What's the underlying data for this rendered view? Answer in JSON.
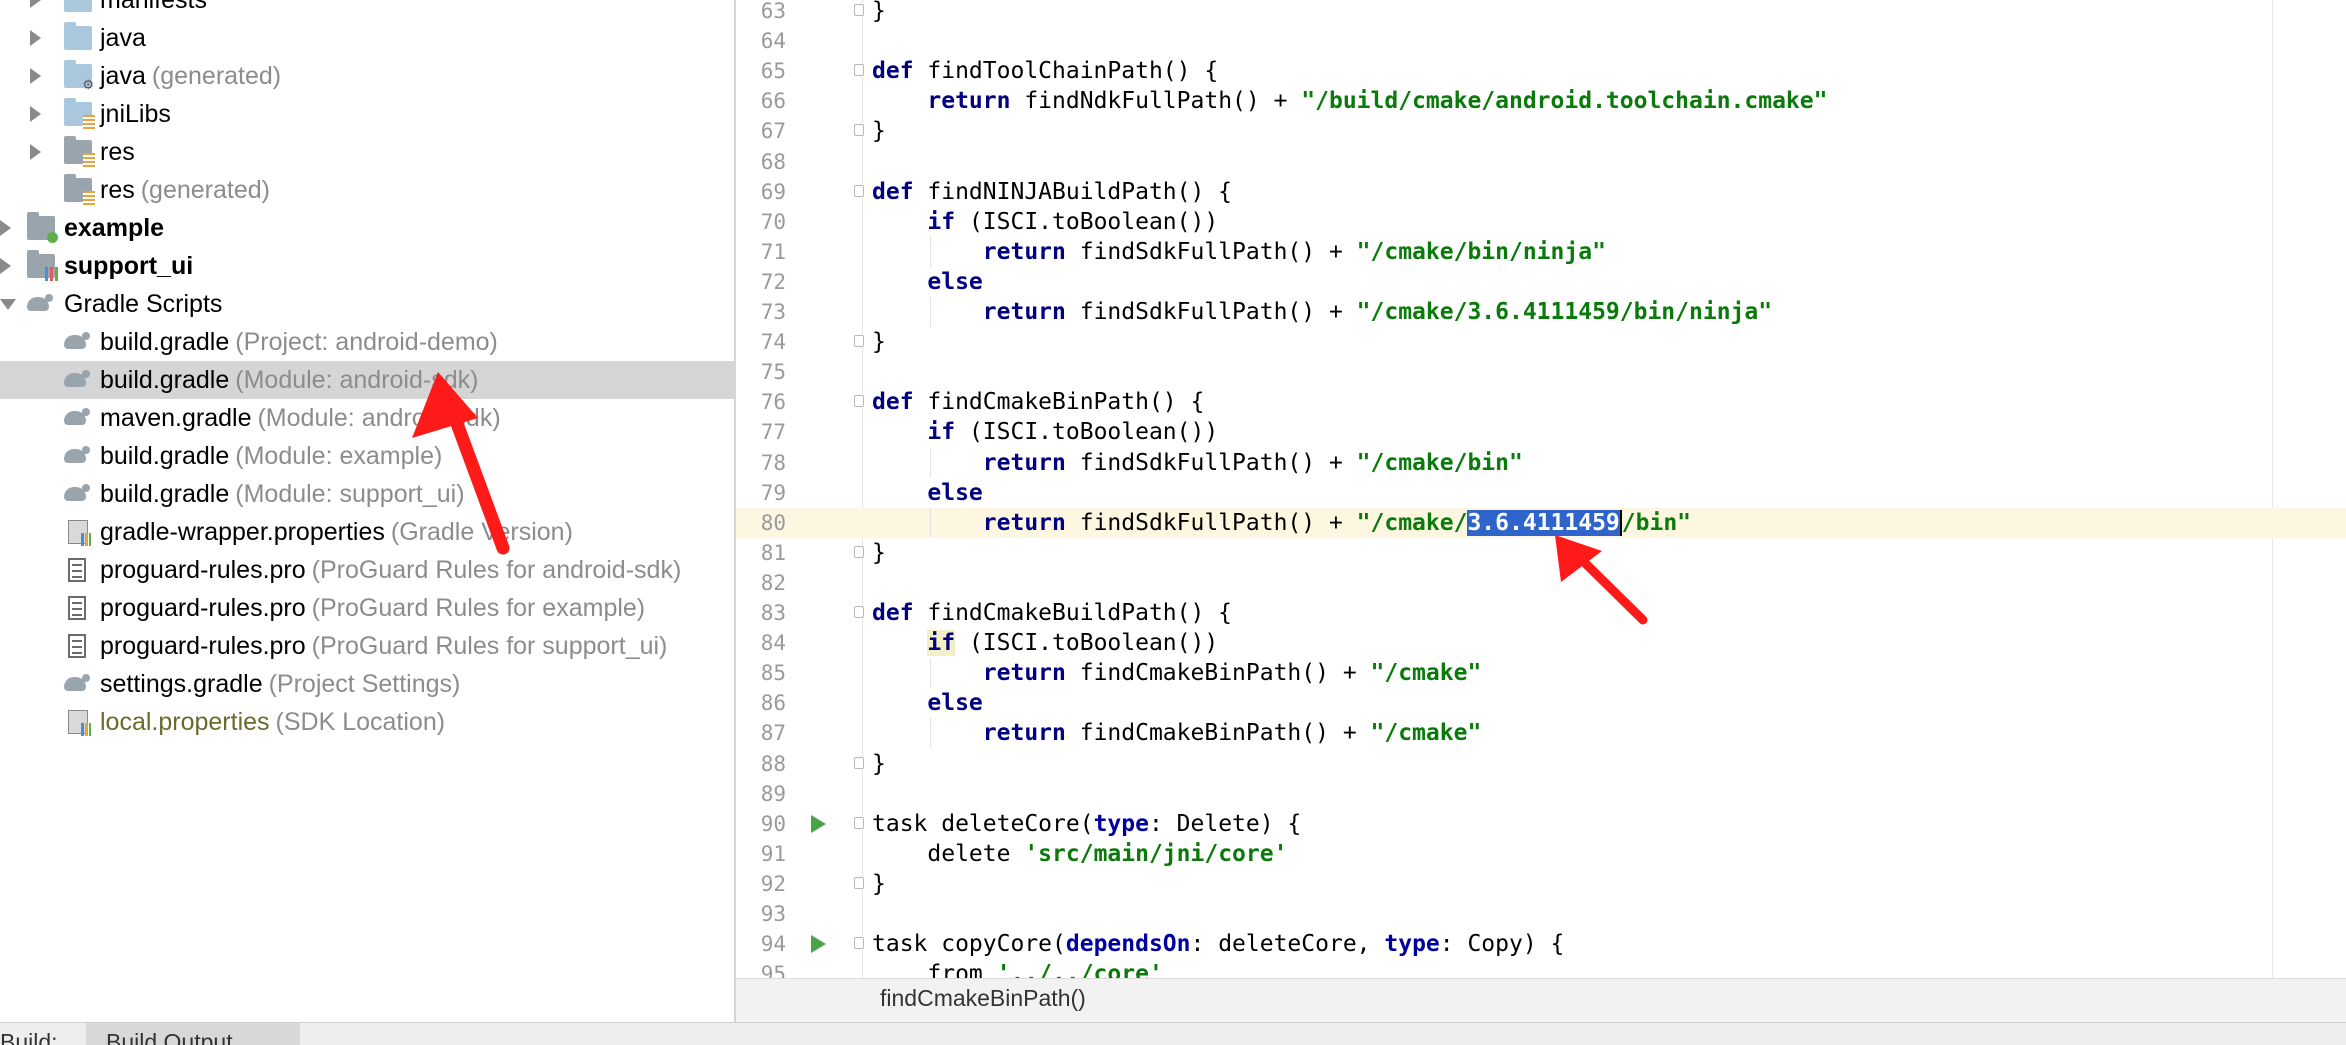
{
  "project_tree": {
    "items": [
      {
        "name": "manifests",
        "hint": "",
        "style": "normal"
      },
      {
        "name": "java",
        "hint": "",
        "style": "normal"
      },
      {
        "name": "java",
        "hint": "(generated)",
        "style": "normal"
      },
      {
        "name": "jniLibs",
        "hint": "",
        "style": "normal"
      },
      {
        "name": "res",
        "hint": "",
        "style": "normal"
      },
      {
        "name": "res",
        "hint": "(generated)",
        "style": "normal"
      },
      {
        "name": "example",
        "hint": "",
        "style": "bold"
      },
      {
        "name": "support_ui",
        "hint": "",
        "style": "bold"
      },
      {
        "name": "Gradle Scripts",
        "hint": "",
        "style": "normal"
      },
      {
        "name": "build.gradle",
        "hint": "(Project: android-demo)",
        "style": "normal"
      },
      {
        "name": "build.gradle",
        "hint": "(Module: android-sdk)",
        "style": "normal"
      },
      {
        "name": "maven.gradle",
        "hint": "(Module: android-sdk)",
        "style": "normal"
      },
      {
        "name": "build.gradle",
        "hint": "(Module: example)",
        "style": "normal"
      },
      {
        "name": "build.gradle",
        "hint": "(Module: support_ui)",
        "style": "normal"
      },
      {
        "name": "gradle-wrapper.properties",
        "hint": "(Gradle Version)",
        "style": "normal"
      },
      {
        "name": "proguard-rules.pro",
        "hint": "(ProGuard Rules for android-sdk)",
        "style": "normal"
      },
      {
        "name": "proguard-rules.pro",
        "hint": "(ProGuard Rules for example)",
        "style": "normal"
      },
      {
        "name": "proguard-rules.pro",
        "hint": "(ProGuard Rules for support_ui)",
        "style": "normal"
      },
      {
        "name": "settings.gradle",
        "hint": "(Project Settings)",
        "style": "normal"
      },
      {
        "name": "local.properties",
        "hint": "(SDK Location)",
        "style": "olive"
      }
    ],
    "selected_index": 10
  },
  "editor": {
    "current_line": 80,
    "lines": [
      {
        "n": "63",
        "segs": [
          [
            "}",
            ""
          ]
        ]
      },
      {
        "n": "64",
        "segs": []
      },
      {
        "n": "65",
        "segs": [
          [
            "def",
            "kw"
          ],
          [
            " findToolChainPath() {",
            ""
          ]
        ]
      },
      {
        "n": "66",
        "segs": [
          [
            "    ",
            ""
          ],
          [
            "return",
            "kw"
          ],
          [
            " findNdkFullPath() + ",
            ""
          ],
          [
            "\"/build/cmake/android.toolchain.cmake\"",
            "str"
          ]
        ]
      },
      {
        "n": "67",
        "segs": [
          [
            "}",
            ""
          ]
        ]
      },
      {
        "n": "68",
        "segs": []
      },
      {
        "n": "69",
        "segs": [
          [
            "def",
            "kw"
          ],
          [
            " findNINJABuildPath() {",
            ""
          ]
        ]
      },
      {
        "n": "70",
        "segs": [
          [
            "    ",
            ""
          ],
          [
            "if",
            "kw"
          ],
          [
            " (ISCI.toBoolean())",
            ""
          ]
        ]
      },
      {
        "n": "71",
        "segs": [
          [
            "        ",
            ""
          ],
          [
            "return",
            "kw"
          ],
          [
            " findSdkFullPath() + ",
            ""
          ],
          [
            "\"/cmake/bin/ninja\"",
            "str"
          ]
        ]
      },
      {
        "n": "72",
        "segs": [
          [
            "    ",
            ""
          ],
          [
            "else",
            "kw"
          ]
        ]
      },
      {
        "n": "73",
        "segs": [
          [
            "        ",
            ""
          ],
          [
            "return",
            "kw"
          ],
          [
            " findSdkFullPath() + ",
            ""
          ],
          [
            "\"/cmake/3.6.4111459/bin/ninja\"",
            "str"
          ]
        ]
      },
      {
        "n": "74",
        "segs": [
          [
            "}",
            ""
          ]
        ]
      },
      {
        "n": "75",
        "segs": []
      },
      {
        "n": "76",
        "segs": [
          [
            "def",
            "kw"
          ],
          [
            " findCmakeBinPath() {",
            ""
          ]
        ]
      },
      {
        "n": "77",
        "segs": [
          [
            "    ",
            ""
          ],
          [
            "if",
            "kw"
          ],
          [
            " (ISCI.toBoolean())",
            ""
          ]
        ]
      },
      {
        "n": "78",
        "segs": [
          [
            "        ",
            ""
          ],
          [
            "return",
            "kw"
          ],
          [
            " findSdkFullPath() + ",
            ""
          ],
          [
            "\"/cmake/bin\"",
            "str"
          ]
        ]
      },
      {
        "n": "79",
        "segs": [
          [
            "    ",
            ""
          ],
          [
            "else",
            "kw"
          ]
        ]
      },
      {
        "n": "80",
        "segs": [
          [
            "        ",
            ""
          ],
          [
            "return",
            "kw"
          ],
          [
            " findSdkFullPath() + ",
            ""
          ],
          [
            "\"/cmake/",
            "str"
          ],
          [
            "3.6.4111459",
            "str sel"
          ],
          [
            "/bin\"",
            "str caret"
          ]
        ]
      },
      {
        "n": "81",
        "segs": [
          [
            "}",
            ""
          ]
        ]
      },
      {
        "n": "82",
        "segs": []
      },
      {
        "n": "83",
        "segs": [
          [
            "def",
            "kw"
          ],
          [
            " findCmakeBuildPath() {",
            ""
          ]
        ]
      },
      {
        "n": "84",
        "segs": [
          [
            "    ",
            ""
          ],
          [
            "if",
            "kw ifhl"
          ],
          [
            " (ISCI.toBoolean())",
            ""
          ]
        ]
      },
      {
        "n": "85",
        "segs": [
          [
            "        ",
            ""
          ],
          [
            "return",
            "kw"
          ],
          [
            " findCmakeBinPath() + ",
            ""
          ],
          [
            "\"/cmake\"",
            "str"
          ]
        ]
      },
      {
        "n": "86",
        "segs": [
          [
            "    ",
            ""
          ],
          [
            "else",
            "kw"
          ]
        ]
      },
      {
        "n": "87",
        "segs": [
          [
            "        ",
            ""
          ],
          [
            "return",
            "kw"
          ],
          [
            " findCmakeBinPath() + ",
            ""
          ],
          [
            "\"/cmake\"",
            "str"
          ]
        ]
      },
      {
        "n": "88",
        "segs": [
          [
            "}",
            ""
          ]
        ]
      },
      {
        "n": "89",
        "segs": []
      },
      {
        "n": "90",
        "segs": [
          [
            "task deleteCore(",
            ""
          ],
          [
            "type",
            "named"
          ],
          [
            ": Delete) {",
            ""
          ]
        ]
      },
      {
        "n": "91",
        "segs": [
          [
            "    delete ",
            ""
          ],
          [
            "'src/main/jni/core'",
            "str"
          ]
        ]
      },
      {
        "n": "92",
        "segs": [
          [
            "}",
            ""
          ]
        ]
      },
      {
        "n": "93",
        "segs": []
      },
      {
        "n": "94",
        "segs": [
          [
            "task copyCore(",
            ""
          ],
          [
            "dependsOn",
            "named"
          ],
          [
            ": deleteCore, ",
            ""
          ],
          [
            "type",
            "named"
          ],
          [
            ": Copy) {",
            ""
          ]
        ]
      },
      {
        "n": "95",
        "segs": [
          [
            "    from ",
            ""
          ],
          [
            "'../../core'",
            "str"
          ]
        ]
      }
    ]
  },
  "breadcrumb": "findCmakeBinPath()",
  "bottom_bar": {
    "build_label": "Build:",
    "build_output_tab": "Build Output"
  },
  "icons": {
    "expand": "chevron-right-icon",
    "collapse": "chevron-down-icon",
    "folder": "folder-icon",
    "module": "module-icon",
    "gradle": "gradle-elephant-icon",
    "file": "file-icon",
    "run": "run-gutter-icon",
    "fold": "fold-marker-icon"
  },
  "colors": {
    "keyword": "#000080",
    "string": "#0a7a0a",
    "selection": "#2f65ca",
    "current_line": "#fdf7e2",
    "annotation_arrow": "#ff1a1a"
  }
}
